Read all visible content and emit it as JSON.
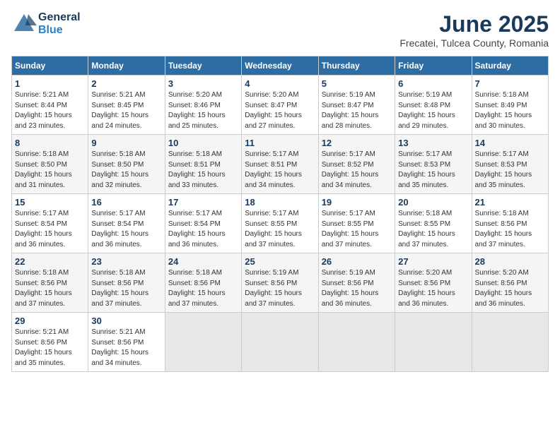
{
  "logo": {
    "general": "General",
    "blue": "Blue"
  },
  "title": "June 2025",
  "subtitle": "Frecatei, Tulcea County, Romania",
  "weekdays": [
    "Sunday",
    "Monday",
    "Tuesday",
    "Wednesday",
    "Thursday",
    "Friday",
    "Saturday"
  ],
  "weeks": [
    [
      {
        "day": "1",
        "info": "Sunrise: 5:21 AM\nSunset: 8:44 PM\nDaylight: 15 hours\nand 23 minutes."
      },
      {
        "day": "2",
        "info": "Sunrise: 5:21 AM\nSunset: 8:45 PM\nDaylight: 15 hours\nand 24 minutes."
      },
      {
        "day": "3",
        "info": "Sunrise: 5:20 AM\nSunset: 8:46 PM\nDaylight: 15 hours\nand 25 minutes."
      },
      {
        "day": "4",
        "info": "Sunrise: 5:20 AM\nSunset: 8:47 PM\nDaylight: 15 hours\nand 27 minutes."
      },
      {
        "day": "5",
        "info": "Sunrise: 5:19 AM\nSunset: 8:47 PM\nDaylight: 15 hours\nand 28 minutes."
      },
      {
        "day": "6",
        "info": "Sunrise: 5:19 AM\nSunset: 8:48 PM\nDaylight: 15 hours\nand 29 minutes."
      },
      {
        "day": "7",
        "info": "Sunrise: 5:18 AM\nSunset: 8:49 PM\nDaylight: 15 hours\nand 30 minutes."
      }
    ],
    [
      {
        "day": "8",
        "info": "Sunrise: 5:18 AM\nSunset: 8:50 PM\nDaylight: 15 hours\nand 31 minutes."
      },
      {
        "day": "9",
        "info": "Sunrise: 5:18 AM\nSunset: 8:50 PM\nDaylight: 15 hours\nand 32 minutes."
      },
      {
        "day": "10",
        "info": "Sunrise: 5:18 AM\nSunset: 8:51 PM\nDaylight: 15 hours\nand 33 minutes."
      },
      {
        "day": "11",
        "info": "Sunrise: 5:17 AM\nSunset: 8:51 PM\nDaylight: 15 hours\nand 34 minutes."
      },
      {
        "day": "12",
        "info": "Sunrise: 5:17 AM\nSunset: 8:52 PM\nDaylight: 15 hours\nand 34 minutes."
      },
      {
        "day": "13",
        "info": "Sunrise: 5:17 AM\nSunset: 8:53 PM\nDaylight: 15 hours\nand 35 minutes."
      },
      {
        "day": "14",
        "info": "Sunrise: 5:17 AM\nSunset: 8:53 PM\nDaylight: 15 hours\nand 35 minutes."
      }
    ],
    [
      {
        "day": "15",
        "info": "Sunrise: 5:17 AM\nSunset: 8:54 PM\nDaylight: 15 hours\nand 36 minutes."
      },
      {
        "day": "16",
        "info": "Sunrise: 5:17 AM\nSunset: 8:54 PM\nDaylight: 15 hours\nand 36 minutes."
      },
      {
        "day": "17",
        "info": "Sunrise: 5:17 AM\nSunset: 8:54 PM\nDaylight: 15 hours\nand 36 minutes."
      },
      {
        "day": "18",
        "info": "Sunrise: 5:17 AM\nSunset: 8:55 PM\nDaylight: 15 hours\nand 37 minutes."
      },
      {
        "day": "19",
        "info": "Sunrise: 5:17 AM\nSunset: 8:55 PM\nDaylight: 15 hours\nand 37 minutes."
      },
      {
        "day": "20",
        "info": "Sunrise: 5:18 AM\nSunset: 8:55 PM\nDaylight: 15 hours\nand 37 minutes."
      },
      {
        "day": "21",
        "info": "Sunrise: 5:18 AM\nSunset: 8:56 PM\nDaylight: 15 hours\nand 37 minutes."
      }
    ],
    [
      {
        "day": "22",
        "info": "Sunrise: 5:18 AM\nSunset: 8:56 PM\nDaylight: 15 hours\nand 37 minutes."
      },
      {
        "day": "23",
        "info": "Sunrise: 5:18 AM\nSunset: 8:56 PM\nDaylight: 15 hours\nand 37 minutes."
      },
      {
        "day": "24",
        "info": "Sunrise: 5:18 AM\nSunset: 8:56 PM\nDaylight: 15 hours\nand 37 minutes."
      },
      {
        "day": "25",
        "info": "Sunrise: 5:19 AM\nSunset: 8:56 PM\nDaylight: 15 hours\nand 37 minutes."
      },
      {
        "day": "26",
        "info": "Sunrise: 5:19 AM\nSunset: 8:56 PM\nDaylight: 15 hours\nand 36 minutes."
      },
      {
        "day": "27",
        "info": "Sunrise: 5:20 AM\nSunset: 8:56 PM\nDaylight: 15 hours\nand 36 minutes."
      },
      {
        "day": "28",
        "info": "Sunrise: 5:20 AM\nSunset: 8:56 PM\nDaylight: 15 hours\nand 36 minutes."
      }
    ],
    [
      {
        "day": "29",
        "info": "Sunrise: 5:21 AM\nSunset: 8:56 PM\nDaylight: 15 hours\nand 35 minutes."
      },
      {
        "day": "30",
        "info": "Sunrise: 5:21 AM\nSunset: 8:56 PM\nDaylight: 15 hours\nand 34 minutes."
      },
      {
        "day": "",
        "info": "",
        "empty": true
      },
      {
        "day": "",
        "info": "",
        "empty": true
      },
      {
        "day": "",
        "info": "",
        "empty": true
      },
      {
        "day": "",
        "info": "",
        "empty": true
      },
      {
        "day": "",
        "info": "",
        "empty": true
      }
    ]
  ]
}
